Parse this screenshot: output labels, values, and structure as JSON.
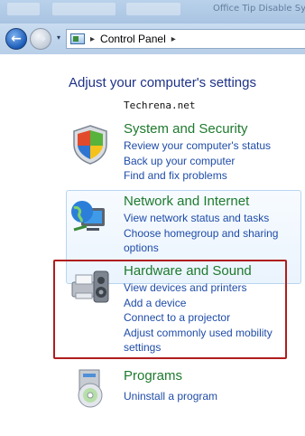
{
  "window": {
    "ghost_title": "Office Tip Disable System"
  },
  "navbar": {
    "address_crumb": "Control Panel",
    "separator": "▸",
    "back_glyph": "←",
    "forward_glyph": "→",
    "dropdown_glyph": "▾"
  },
  "main": {
    "heading": "Adjust your computer's settings",
    "watermark": "Techrena.net",
    "categories": [
      {
        "title": "System and Security",
        "icon": "shield-icon",
        "links": [
          "Review your computer's status",
          "Back up your computer",
          "Find and fix problems"
        ]
      },
      {
        "title": "Network and Internet",
        "icon": "network-globe-icon",
        "links": [
          "View network status and tasks",
          "Choose homegroup and sharing",
          "options"
        ]
      },
      {
        "title": "Hardware and Sound",
        "icon": "printer-speaker-icon",
        "links": [
          "View devices and printers",
          "Add a device",
          "Connect to a projector",
          "Adjust commonly used mobility",
          "settings"
        ]
      },
      {
        "title": "Programs",
        "icon": "programs-disc-icon",
        "links": [
          "Uninstall a program"
        ]
      }
    ]
  },
  "colors": {
    "heading": "#1e3287",
    "category_title": "#1e7a2e",
    "link": "#1f4ca8",
    "highlight_border": "#b01d1d"
  }
}
